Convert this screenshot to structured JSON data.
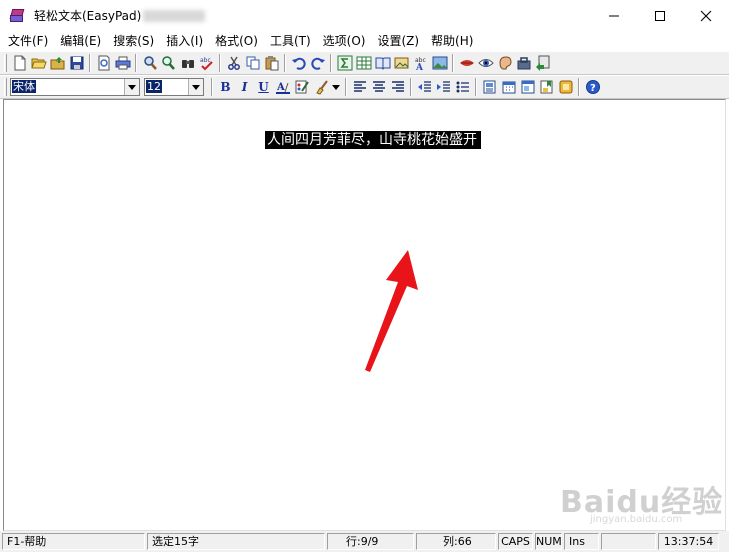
{
  "window": {
    "title": "轻松文本(EasyPad)",
    "app_icon": "book-stack-icon",
    "controls": [
      "minimize-icon",
      "maximize-icon",
      "close-icon"
    ]
  },
  "menu": [
    "文件(F)",
    "编辑(E)",
    "搜索(S)",
    "插入(I)",
    "格式(O)",
    "工具(T)",
    "选项(O)",
    "设置(Z)",
    "帮助(H)"
  ],
  "toolbar2": {
    "font_name": "宋体",
    "font_size": "12",
    "bold_label": "B",
    "italic_label": "I",
    "underline_label": "U"
  },
  "editor": {
    "selected_text": "人间四月芳菲尽，山寺桃花始盛开"
  },
  "watermark": {
    "text": "Baidu经验",
    "sub": "jingyan.baidu.com"
  },
  "status": {
    "help": "F1-帮助",
    "selection": "选定15字",
    "line": "行:9/9",
    "col": "列:66",
    "caps": "CAPS",
    "num": "NUM",
    "ins": "Ins",
    "time": "13:37:54"
  },
  "colors": {
    "selection_bg": "#000000",
    "selection_fg": "#ffffff",
    "arrow": "#e8141a",
    "toolbar_bg": "#f0f0f0"
  }
}
